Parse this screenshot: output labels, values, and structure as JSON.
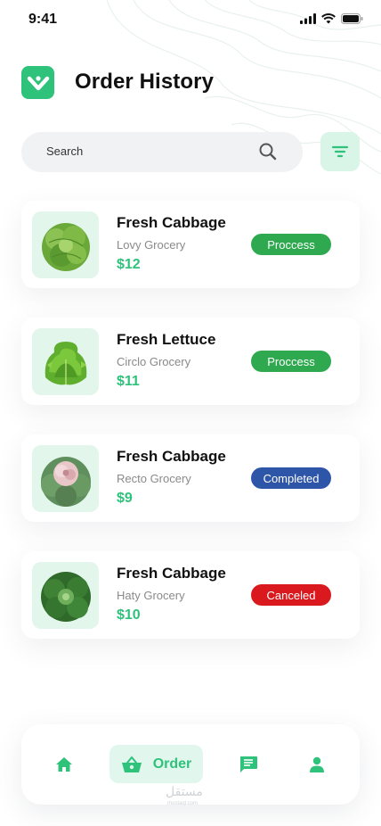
{
  "status_bar": {
    "time": "9:41"
  },
  "header": {
    "title": "Order History",
    "logo_icon": "brand-logo-icon"
  },
  "search": {
    "placeholder": "Search",
    "value": ""
  },
  "colors": {
    "accent": "#2ec27a",
    "process": "#2ea94f",
    "completed": "#2d55a8",
    "canceled": "#d9191d"
  },
  "orders": [
    {
      "name": "Fresh Cabbage",
      "store": "Lovy Grocery",
      "price": "$12",
      "status": "Proccess",
      "status_color": "#2ea94f"
    },
    {
      "name": "Fresh Lettuce",
      "store": "Circlo Grocery",
      "price": "$11",
      "status": "Proccess",
      "status_color": "#2ea94f"
    },
    {
      "name": "Fresh Cabbage",
      "store": "Recto Grocery",
      "price": "$9",
      "status": "Completed",
      "status_color": "#2d55a8"
    },
    {
      "name": "Fresh Cabbage",
      "store": "Haty Grocery",
      "price": "$10",
      "status": "Canceled",
      "status_color": "#d9191d"
    }
  ],
  "nav": {
    "items": [
      {
        "icon": "home-icon"
      },
      {
        "icon": "basket-icon",
        "label": "Order",
        "active": true
      },
      {
        "icon": "chat-icon"
      },
      {
        "icon": "profile-icon"
      }
    ]
  },
  "watermark": {
    "text": "مستقل",
    "sub": "mostaql.com"
  }
}
